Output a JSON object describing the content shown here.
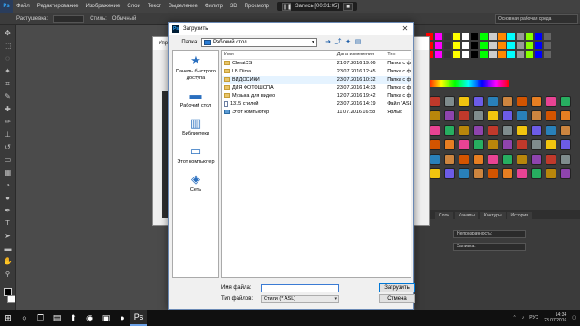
{
  "app": {
    "logo": "Ps",
    "menu": [
      "Файл",
      "Редактирование",
      "Изображение",
      "Слои",
      "Текст",
      "Выделение",
      "Фильтр",
      "3D",
      "Просмотр"
    ],
    "recording": {
      "label": "Запись [00:01:05]"
    },
    "options": {
      "rasterize_label": "Растушевка:",
      "styles_label": "Стиль:",
      "normal": "Обычный"
    },
    "workspace": "Основная рабочая среда"
  },
  "panels": {
    "tabs": [
      "Слои",
      "Каналы",
      "Контуры",
      "История"
    ],
    "blend_mode": "Непрозрачность:",
    "lock": "Заливка:"
  },
  "back_dialog": {
    "title": "Упра"
  },
  "dialog": {
    "title": "Загрузить",
    "folder_label": "Папка:",
    "folder_value": "Рабочий стол",
    "places": [
      {
        "icon": "star-icon",
        "label": "Панель быстрого доступа"
      },
      {
        "icon": "desktop-icon",
        "label": "Рабочий стол"
      },
      {
        "icon": "library-icon",
        "label": "Библиотеки"
      },
      {
        "icon": "computer-icon",
        "label": "Этот компьютер"
      },
      {
        "icon": "network-icon",
        "label": "Сеть"
      }
    ],
    "columns": {
      "name": "Имя",
      "date": "Дата изменения",
      "type": "Тип"
    },
    "files": [
      {
        "icon": "folder",
        "name": "CheatCS",
        "date": "21.07.2016 19:06",
        "type": "Папка с ф"
      },
      {
        "icon": "folder",
        "name": "LB Dima",
        "date": "23.07.2016 12:45",
        "type": "Папка с ф"
      },
      {
        "icon": "folder",
        "name": "ВИДОСИКИ",
        "date": "23.07.2016 10:32",
        "type": "Папка с ф"
      },
      {
        "icon": "folder",
        "name": "ДЛЯ ФОТОШОПА",
        "date": "23.07.2016 14:33",
        "type": "Папка с ф"
      },
      {
        "icon": "folder",
        "name": "Музыка для видео",
        "date": "12.07.2016 19:42",
        "type": "Папка с ф"
      },
      {
        "icon": "file",
        "name": "1315 стилей",
        "date": "23.07.2016 14:19",
        "type": "Файл \"ASL\""
      },
      {
        "icon": "pc",
        "name": "Этот компьютер",
        "date": "11.07.2016 16:58",
        "type": "Ярлык"
      }
    ],
    "filename_label": "Имя файла:",
    "filename_value": "",
    "filetype_label": "Тип файлов:",
    "filetype_value": "Стили (*.ASL)",
    "load_button": "Загрузить",
    "cancel_button": "Отмена"
  },
  "taskbar": {
    "lang": "РУС",
    "time": "14:34",
    "date": "23.07.2016"
  }
}
